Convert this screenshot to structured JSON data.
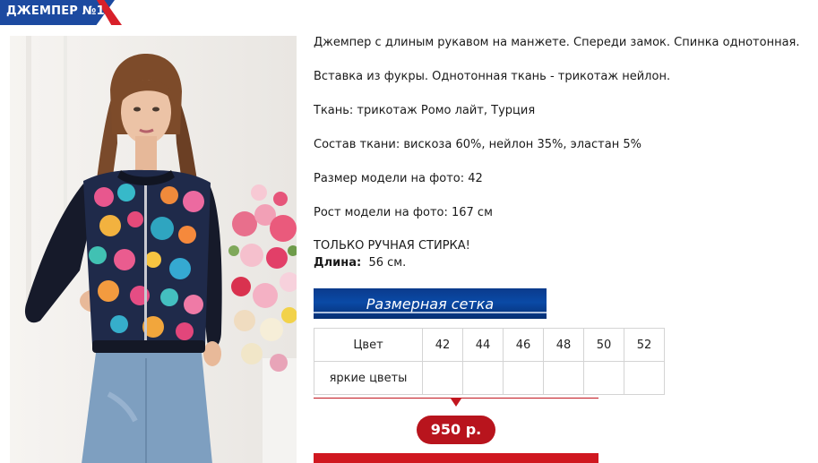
{
  "header": {
    "title": "ДЖЕМПЕР №1"
  },
  "photo": {
    "alt": "Модель в джемпере с цветочным принтом"
  },
  "description": {
    "line1": "Джемпер с длиным рукавом на манжете. Спереди замок. Спинка однотонная.",
    "line2": "Вставка из фукры. Однотонная ткань - трикотаж нейлон.",
    "line3": "Ткань: трикотаж Ромо лайт, Турция",
    "line4": "Состав ткани: вискоза 60%, нейлон 35%, эластан 5%",
    "line5": "Размер модели на фото: 42",
    "line6": "Рост модели на фото: 167 см",
    "line7": "ТОЛЬКО РУЧНАЯ СТИРКА!",
    "length_label": "Длина:",
    "length_value": "56 см."
  },
  "size_chart": {
    "banner": "Размерная сетка",
    "header": [
      "Цвет",
      "42",
      "44",
      "46",
      "48",
      "50",
      "52"
    ],
    "row": [
      "яркие цветы",
      "",
      "",
      "",
      "",
      "",
      ""
    ]
  },
  "price": {
    "value": "950 р."
  }
}
